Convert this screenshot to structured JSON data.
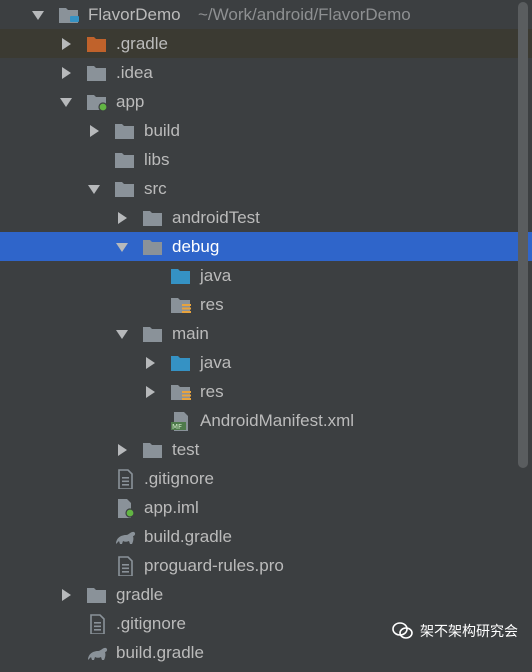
{
  "project": {
    "name": "FlavorDemo",
    "path": "~/Work/android/FlavorDemo"
  },
  "tree": [
    {
      "label": "FlavorDemo",
      "icon": "project-folder-icon",
      "depth": 0,
      "arrow": "down"
    },
    {
      "label": ".gradle",
      "icon": "folder-orange-icon",
      "depth": 1,
      "arrow": "right",
      "state": "highlighted"
    },
    {
      "label": ".idea",
      "icon": "folder-icon",
      "depth": 1,
      "arrow": "right"
    },
    {
      "label": "app",
      "icon": "module-folder-icon",
      "depth": 1,
      "arrow": "down"
    },
    {
      "label": "build",
      "icon": "folder-icon",
      "depth": 2,
      "arrow": "right"
    },
    {
      "label": "libs",
      "icon": "folder-icon",
      "depth": 2,
      "arrow": "none"
    },
    {
      "label": "src",
      "icon": "folder-icon",
      "depth": 2,
      "arrow": "down"
    },
    {
      "label": "androidTest",
      "icon": "folder-icon",
      "depth": 3,
      "arrow": "right"
    },
    {
      "label": "debug",
      "icon": "folder-icon",
      "depth": 3,
      "arrow": "down",
      "state": "selected"
    },
    {
      "label": "java",
      "icon": "source-folder-icon",
      "depth": 4,
      "arrow": "none"
    },
    {
      "label": "res",
      "icon": "resource-folder-icon",
      "depth": 4,
      "arrow": "none"
    },
    {
      "label": "main",
      "icon": "folder-icon",
      "depth": 3,
      "arrow": "down"
    },
    {
      "label": "java",
      "icon": "source-folder-icon",
      "depth": 4,
      "arrow": "right"
    },
    {
      "label": "res",
      "icon": "resource-folder-icon",
      "depth": 4,
      "arrow": "right"
    },
    {
      "label": "AndroidManifest.xml",
      "icon": "manifest-file-icon",
      "depth": 4,
      "arrow": "none"
    },
    {
      "label": "test",
      "icon": "folder-icon",
      "depth": 3,
      "arrow": "right"
    },
    {
      "label": ".gitignore",
      "icon": "text-file-icon",
      "depth": 2,
      "arrow": "none"
    },
    {
      "label": "app.iml",
      "icon": "iml-file-icon",
      "depth": 2,
      "arrow": "none"
    },
    {
      "label": "build.gradle",
      "icon": "gradle-file-icon",
      "depth": 2,
      "arrow": "none"
    },
    {
      "label": "proguard-rules.pro",
      "icon": "text-file-icon",
      "depth": 2,
      "arrow": "none"
    },
    {
      "label": "gradle",
      "icon": "folder-icon",
      "depth": 1,
      "arrow": "right"
    },
    {
      "label": ".gitignore",
      "icon": "text-file-icon",
      "depth": 1,
      "arrow": "none"
    },
    {
      "label": "build.gradle",
      "icon": "gradle-file-icon",
      "depth": 1,
      "arrow": "none"
    }
  ],
  "watermark": {
    "text": "架不架构研究会",
    "icon": "wechat-icon"
  },
  "colors": {
    "selection": "#2f65ca",
    "background": "#3c3f41",
    "folder": "#8a9299",
    "source": "#3592c4"
  }
}
